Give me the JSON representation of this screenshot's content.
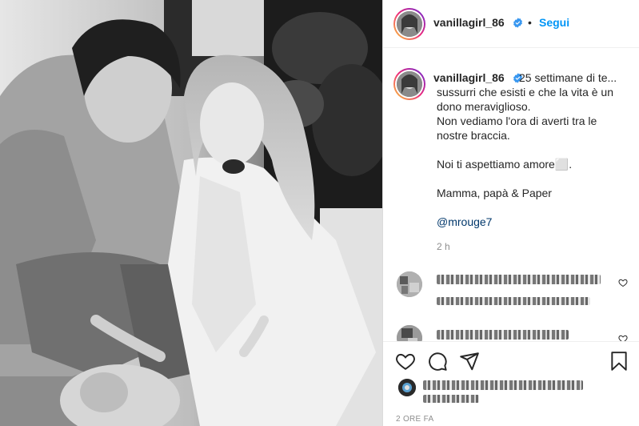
{
  "post": {
    "username": "vanillagirl_86",
    "follow_label": "Segui",
    "separator": "•",
    "caption_lines": [
      "25 settimane di te...",
      "sussurri che esisti e che la vita è un",
      "dono meraviglioso.",
      "Non vediamo l'ora di averti tra le",
      "nostre braccia.",
      "Noi ti aspettiamo amore⬜.",
      "Mamma, papà & Paper"
    ],
    "mention": "@mrouge7",
    "caption_age": "2 h",
    "footer_time": "2 ORE FA"
  },
  "icons": {
    "verified": "verified-badge-icon",
    "like": "heart-icon",
    "comment": "comment-icon",
    "share": "paper-plane-icon",
    "save": "bookmark-icon"
  },
  "colors": {
    "accent": "#0095f6",
    "mention": "#00376b",
    "text": "#262626",
    "muted": "#8e8e8e",
    "verified": "#3897f0"
  }
}
